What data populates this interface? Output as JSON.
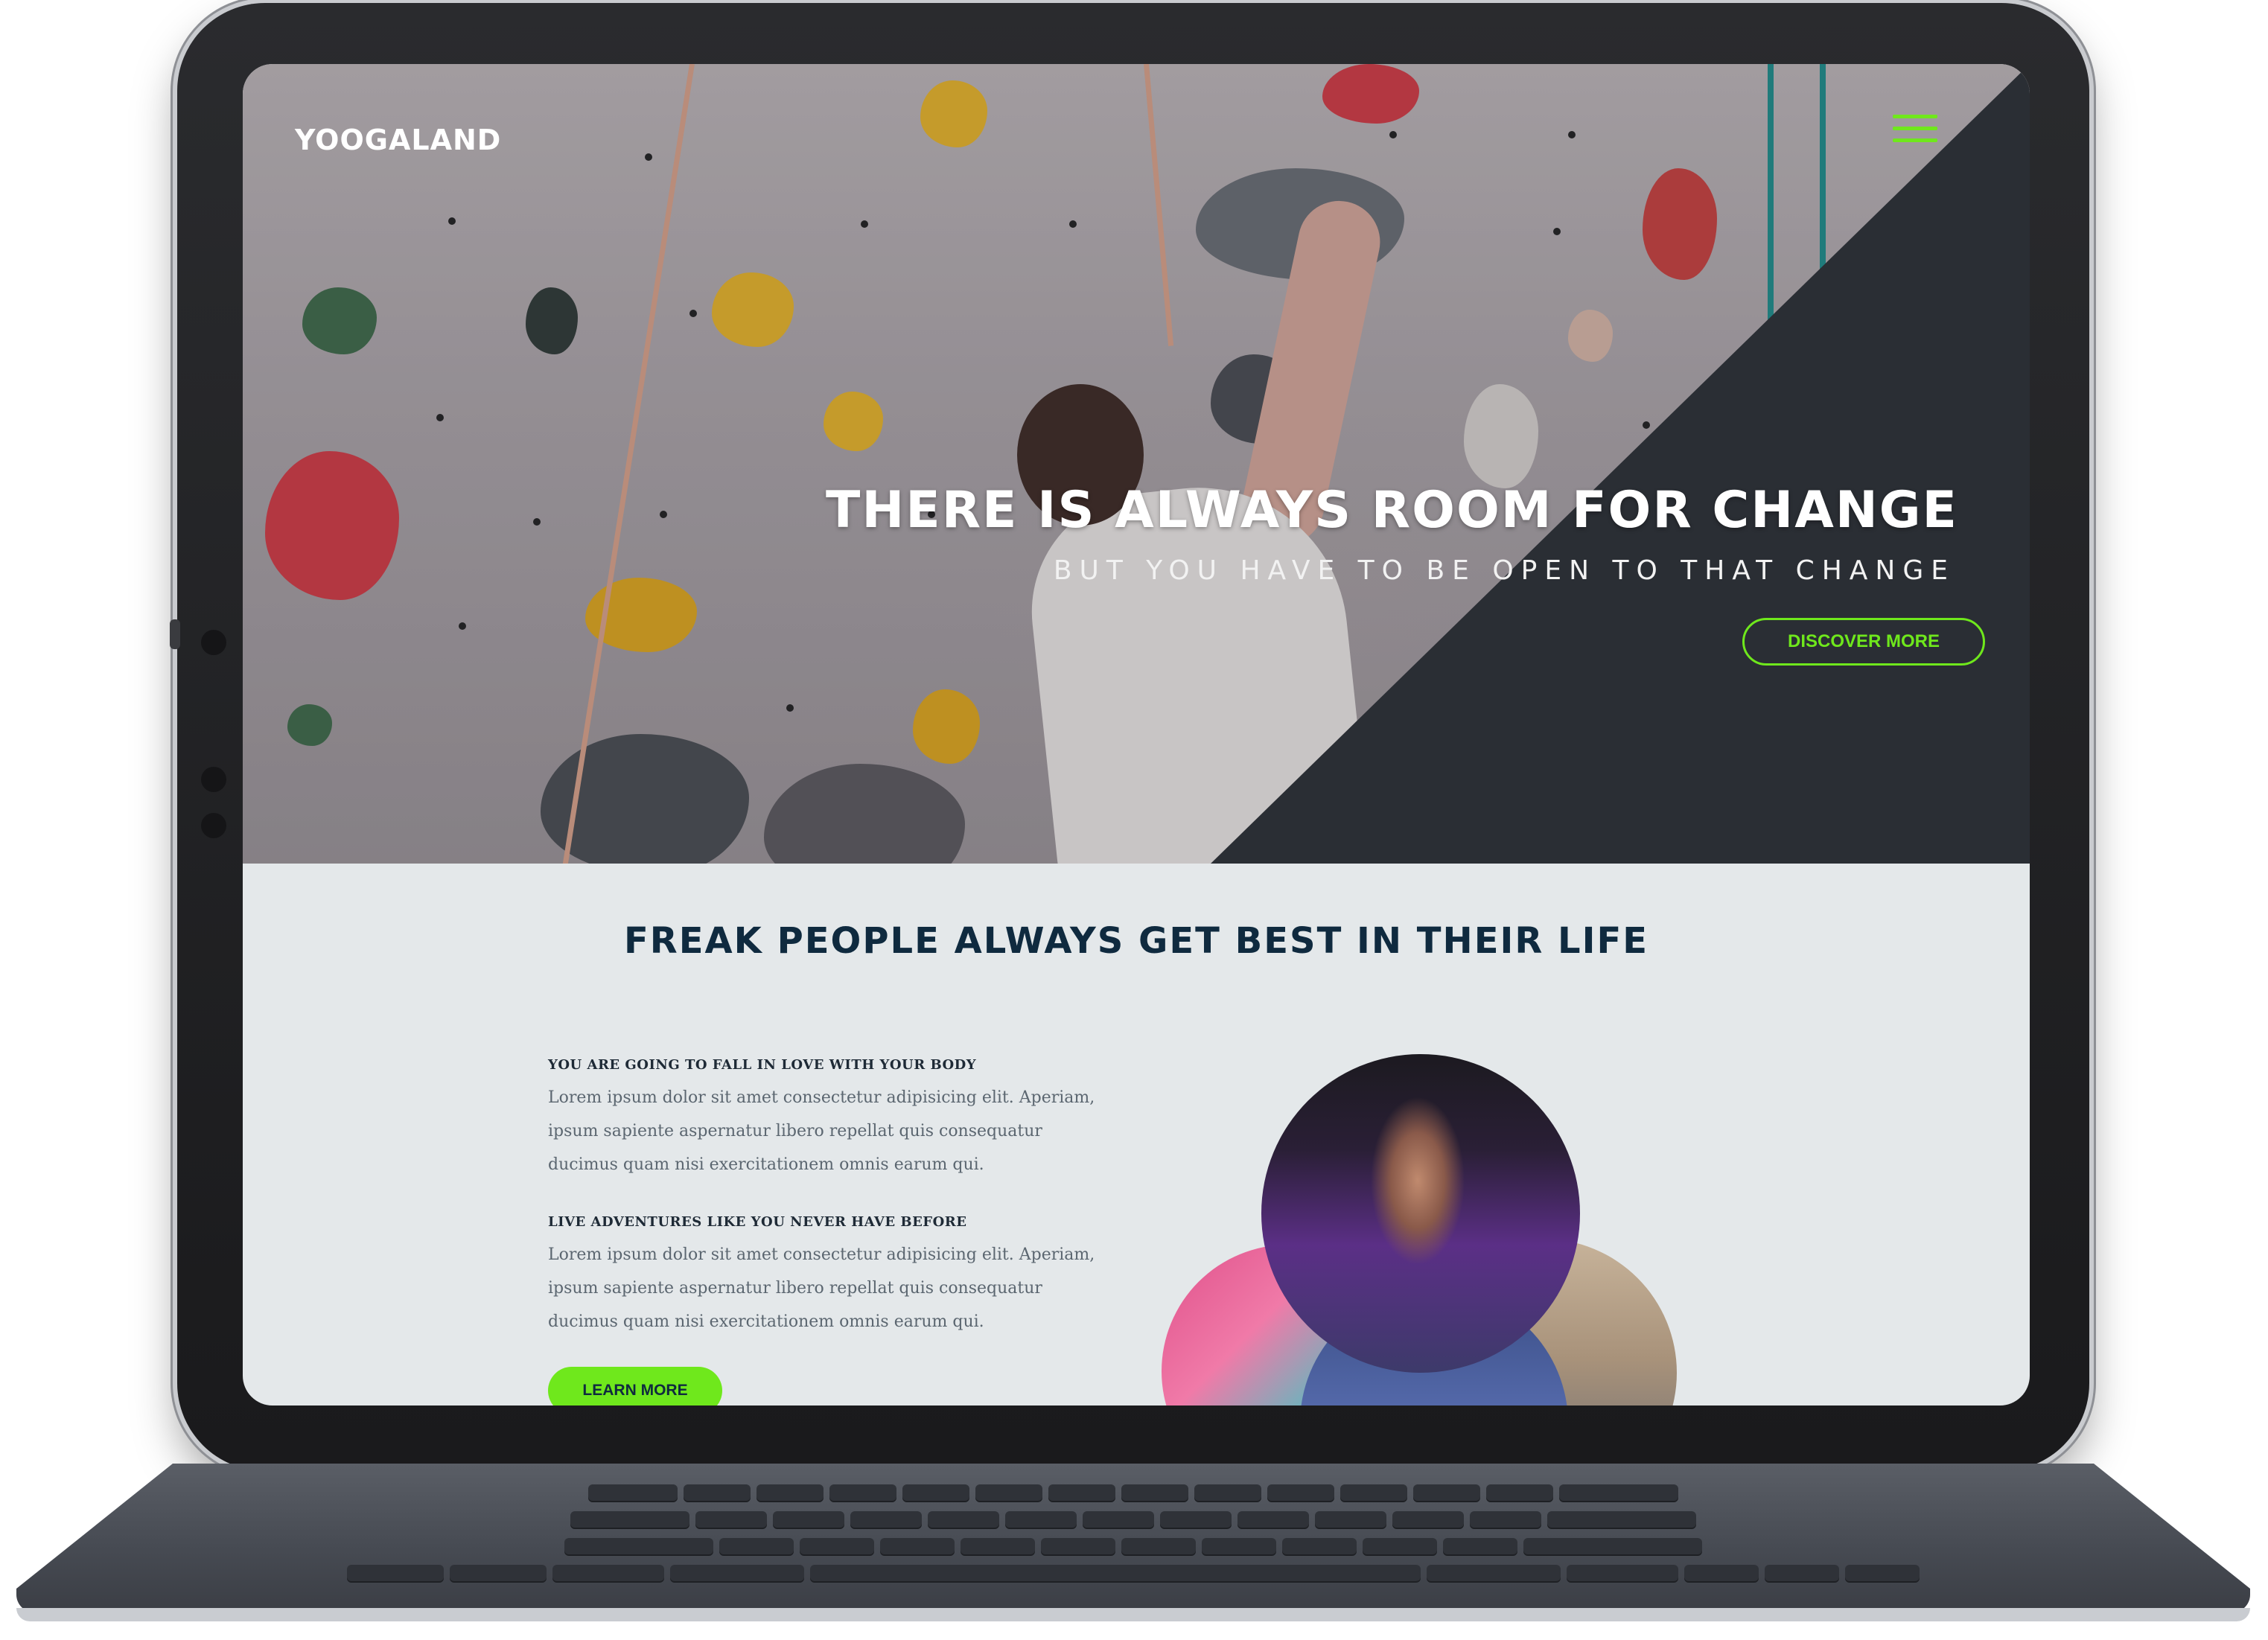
{
  "header": {
    "logo": "YOOGALAND",
    "menu_icon": "hamburger-menu-icon"
  },
  "hero": {
    "title": "THERE IS ALWAYS ROOM FOR CHANGE",
    "subtitle": "BUT YOU HAVE TO BE OPEN TO THAT CHANGE",
    "cta_label": "DISCOVER MORE"
  },
  "about": {
    "section_title": "FREAK PEOPLE ALWAYS GET BEST IN THEIR LIFE",
    "blocks": [
      {
        "heading": "YOU ARE GOING TO FALL IN LOVE WITH YOUR BODY",
        "text": "Lorem ipsum dolor sit amet consectetur adipisicing elit. Aperiam, ipsum sapiente aspernatur libero repellat quis consequatur ducimus quam nisi exercitationem omnis earum qui."
      },
      {
        "heading": "LIVE ADVENTURES LIKE YOU NEVER HAVE BEFORE",
        "text": "Lorem ipsum dolor sit amet consectetur adipisicing elit. Aperiam, ipsum sapiente aspernatur libero repellat quis consequatur ducimus quam nisi exercitationem omnis earum qui."
      }
    ],
    "cta_label": "LEARN MORE"
  },
  "colors": {
    "accent": "#6fe81c",
    "heading": "#0f2a3f",
    "hero_panel": "#2a2e34",
    "section_bg": "#e4e8ea"
  }
}
